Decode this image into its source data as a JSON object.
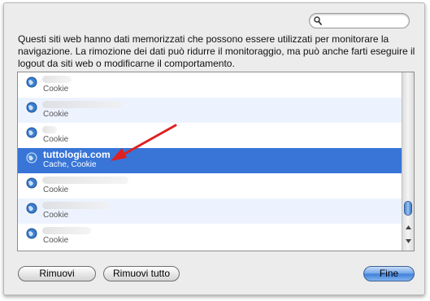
{
  "search": {
    "placeholder": "",
    "value": ""
  },
  "description": "Questi siti web hanno dati memorizzati che possono essere utilizzati per monitorare la navigazione. La rimozione dei dati può ridurre il monitoraggio, ma può anche farti eseguire il logout da siti web o modificarne il comportamento.",
  "sites": [
    {
      "name": "",
      "detail": "Cookie"
    },
    {
      "name": "",
      "detail": "Cookie"
    },
    {
      "name": "",
      "detail": "Cookie"
    },
    {
      "name": "tuttologia.com",
      "detail": "Cache, Cookie"
    },
    {
      "name": "",
      "detail": "Cookie"
    },
    {
      "name": "",
      "detail": "Cookie"
    },
    {
      "name": "",
      "detail": "Cookie"
    }
  ],
  "selected_index": 3,
  "buttons": {
    "remove": "Rimuovi",
    "remove_all": "Rimuovi tutto",
    "done": "Fine"
  },
  "colors": {
    "selection": "#3875d7",
    "annotation_arrow": "#e02020"
  }
}
